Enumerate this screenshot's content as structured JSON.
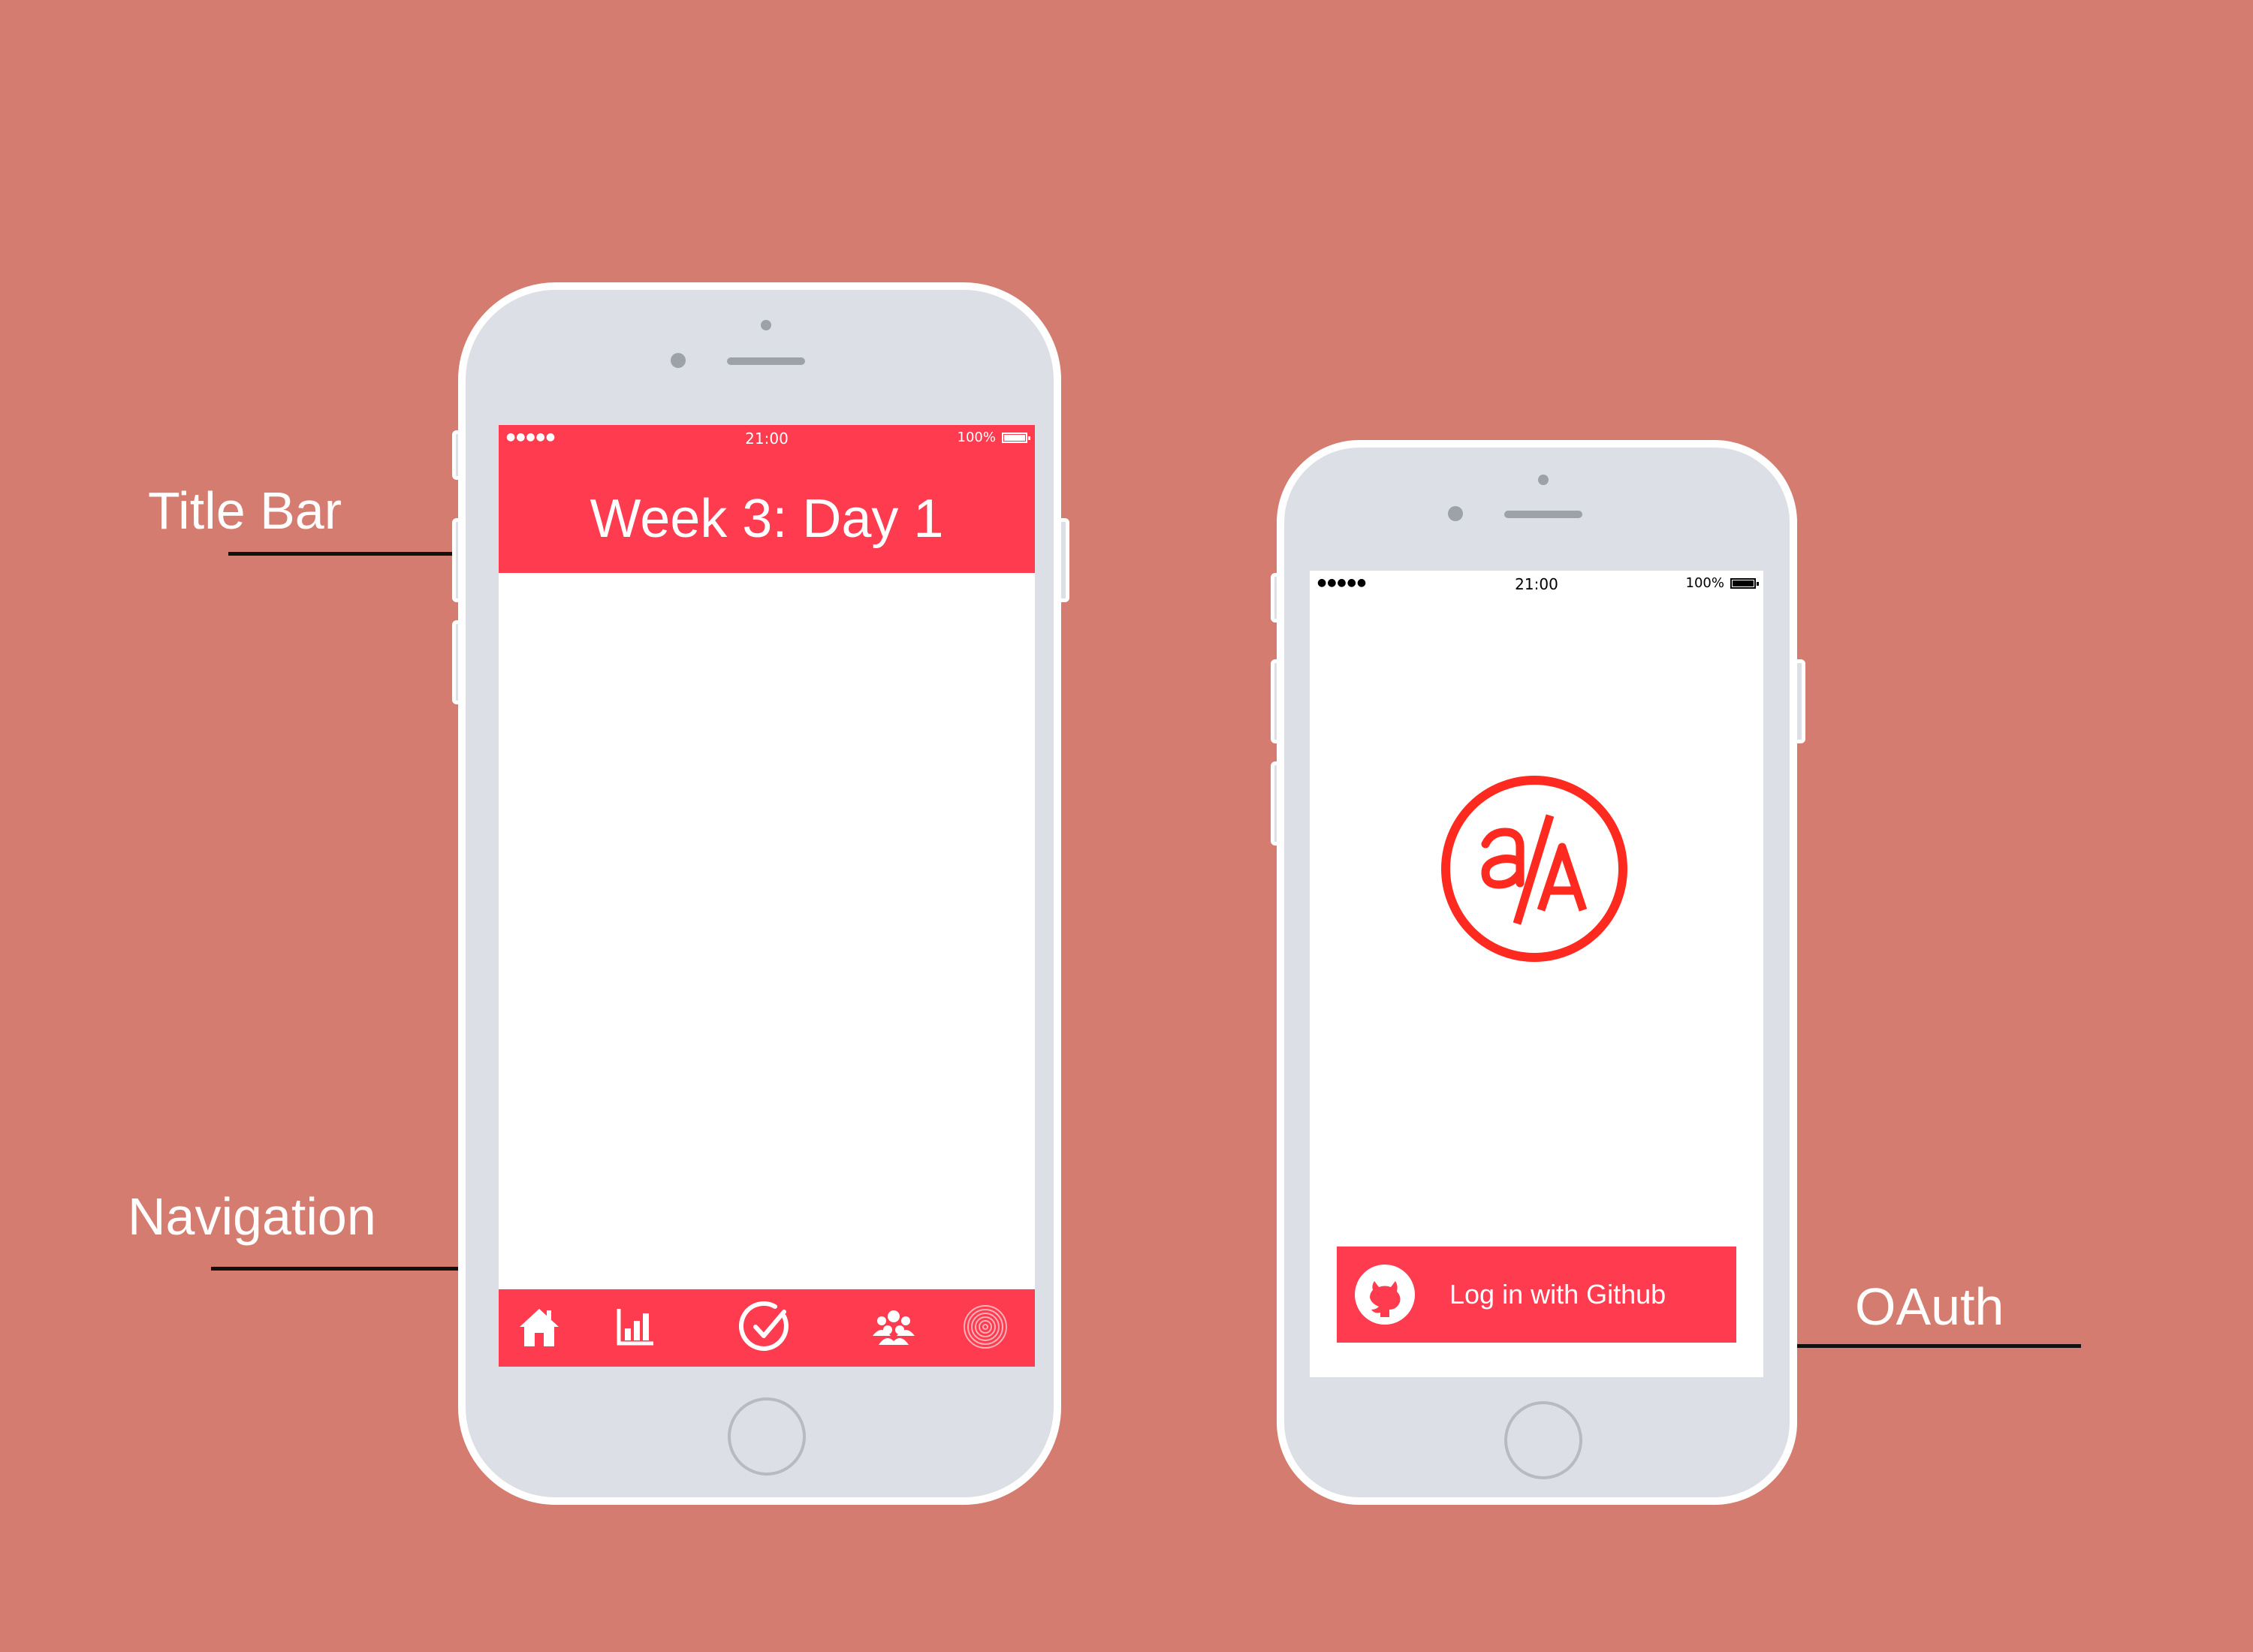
{
  "annotations": {
    "title_bar": "Title Bar",
    "navigation": "Navigation",
    "oauth": "OAuth"
  },
  "left_phone": {
    "status": {
      "signal": "●●●●●",
      "time": "21:00",
      "battery": "100%"
    },
    "title": "Week 3: Day 1",
    "nav_icons": [
      "home-icon",
      "bar-chart-icon",
      "check-circle-icon",
      "group-icon",
      "fingerprint-icon"
    ]
  },
  "right_phone": {
    "status": {
      "signal": "●●●●●",
      "time": "21:00",
      "battery": "100%"
    },
    "logo_text": "a/A",
    "login_button": "Log in with Github"
  },
  "colors": {
    "background": "#d47c6f",
    "accent": "#ff3b4f",
    "logo": "#ff2a1f",
    "phone_body": "#dcdfe6"
  }
}
